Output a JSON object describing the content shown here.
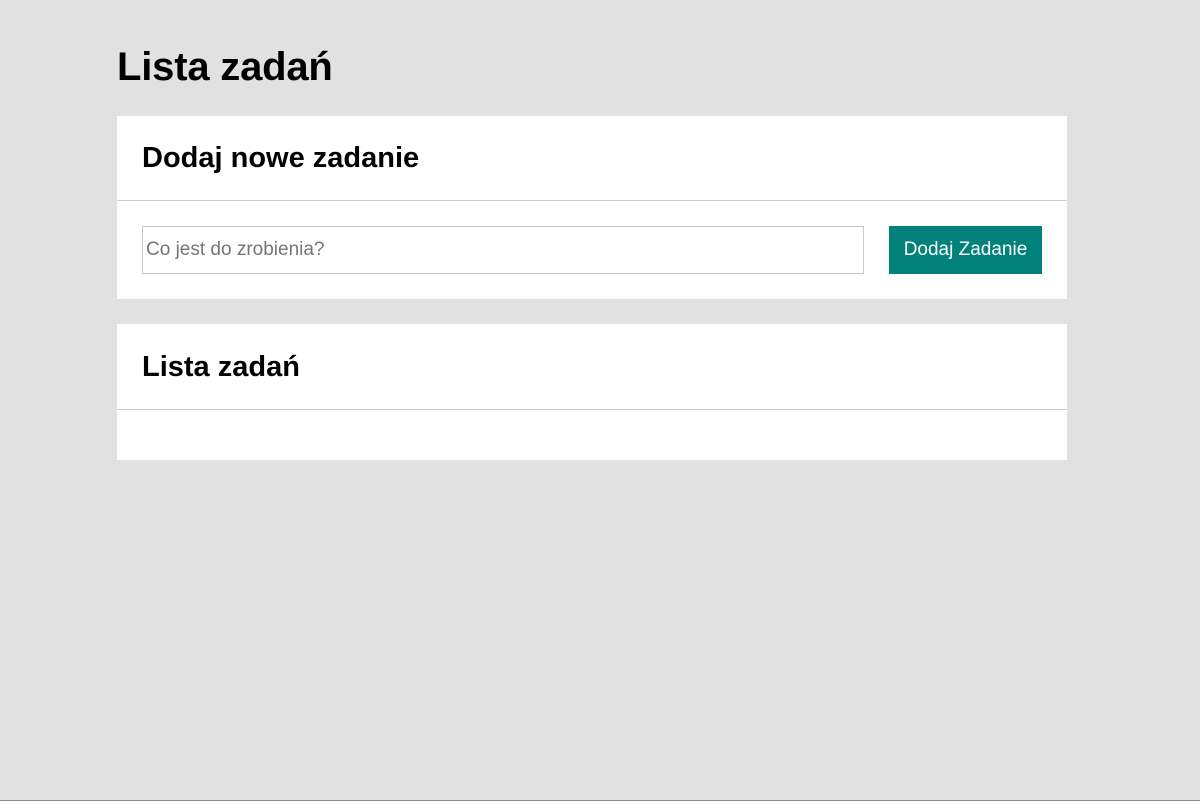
{
  "page": {
    "title": "Lista zadań"
  },
  "add_task_card": {
    "title": "Dodaj nowe zadanie",
    "input": {
      "value": "",
      "placeholder": "Co jest do zrobienia?"
    },
    "button_label": "Dodaj Zadanie"
  },
  "task_list_card": {
    "title": "Lista zadań",
    "tasks": []
  },
  "colors": {
    "background": "#e1e1e1",
    "card": "#ffffff",
    "accent": "#00817a",
    "divider": "#cfcfcf"
  }
}
